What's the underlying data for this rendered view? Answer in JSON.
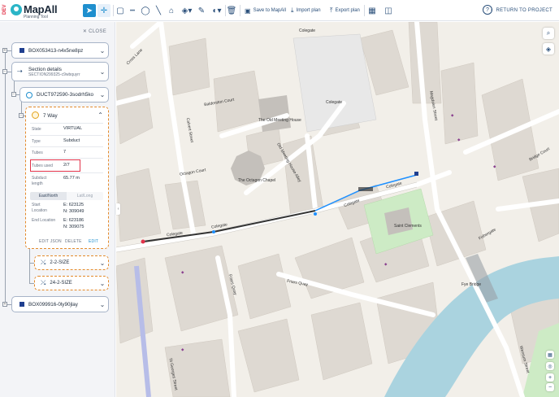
{
  "app": {
    "badge": "DEV",
    "name": "MapAll",
    "subtitle": "Planning Tool"
  },
  "toolbar": {
    "save_label": "Save to MapAll",
    "import_label": "Import plan",
    "export_label": "Export plan",
    "return_label": "RETURN TO PROJECT",
    "help_glyph": "?",
    "accent": "#1f8fce"
  },
  "sidebar": {
    "close_label": "CLOSE",
    "box1": {
      "label": "BOX053413-n4x5ne8pz"
    },
    "section": {
      "label": "Section details",
      "sub": "SECTION299325-c9wbquyrr"
    },
    "duct": {
      "label": "DUCT972590-3sodrh5ko"
    },
    "way": {
      "title": "7 Way",
      "props": [
        {
          "key": "State",
          "value": "VIRTUAL"
        },
        {
          "key": "Type",
          "value": "Subduct"
        },
        {
          "key": "Tubes",
          "value": "7"
        },
        {
          "key": "Tubes used",
          "value": "2/7"
        },
        {
          "key": "Subduct length",
          "value": "65.77 m"
        }
      ],
      "toggle": {
        "on": "East/North",
        "off": "Lat/Long"
      },
      "start_label": "Start Location",
      "start_e": "E: 623125",
      "start_n": "N: 309049",
      "end_label": "End Location",
      "end_e": "E: 623186",
      "end_n": "N: 309075",
      "actions": {
        "json": "EDIT JSON",
        "delete": "DELETE",
        "edit": "EDIT"
      }
    },
    "sub1": {
      "label": "2-2-SIZE"
    },
    "sub2": {
      "label": "24-2-SIZE"
    },
    "box2": {
      "label": "BOX099916-0ly90jlay"
    }
  },
  "map": {
    "streets": [
      "Colegate",
      "Colegate",
      "Colegate",
      "Colegate",
      "Balderston Court",
      "Calvert Street",
      "Octagon Court",
      "Magdalen Street",
      "Friars Quay",
      "Friars Quay",
      "Fye Bridge",
      "Cross Lane",
      "Old Meeting House Alley",
      "St Georges Street",
      "Fishergate",
      "Wensum Street",
      "Bridge Court"
    ],
    "places": [
      "The Octagon Chapel",
      "The Old Meeting House",
      "Saint Clements",
      "Colegate",
      "Colegate"
    ],
    "route_color": "#1e90ff",
    "duct_color": "#333333"
  }
}
